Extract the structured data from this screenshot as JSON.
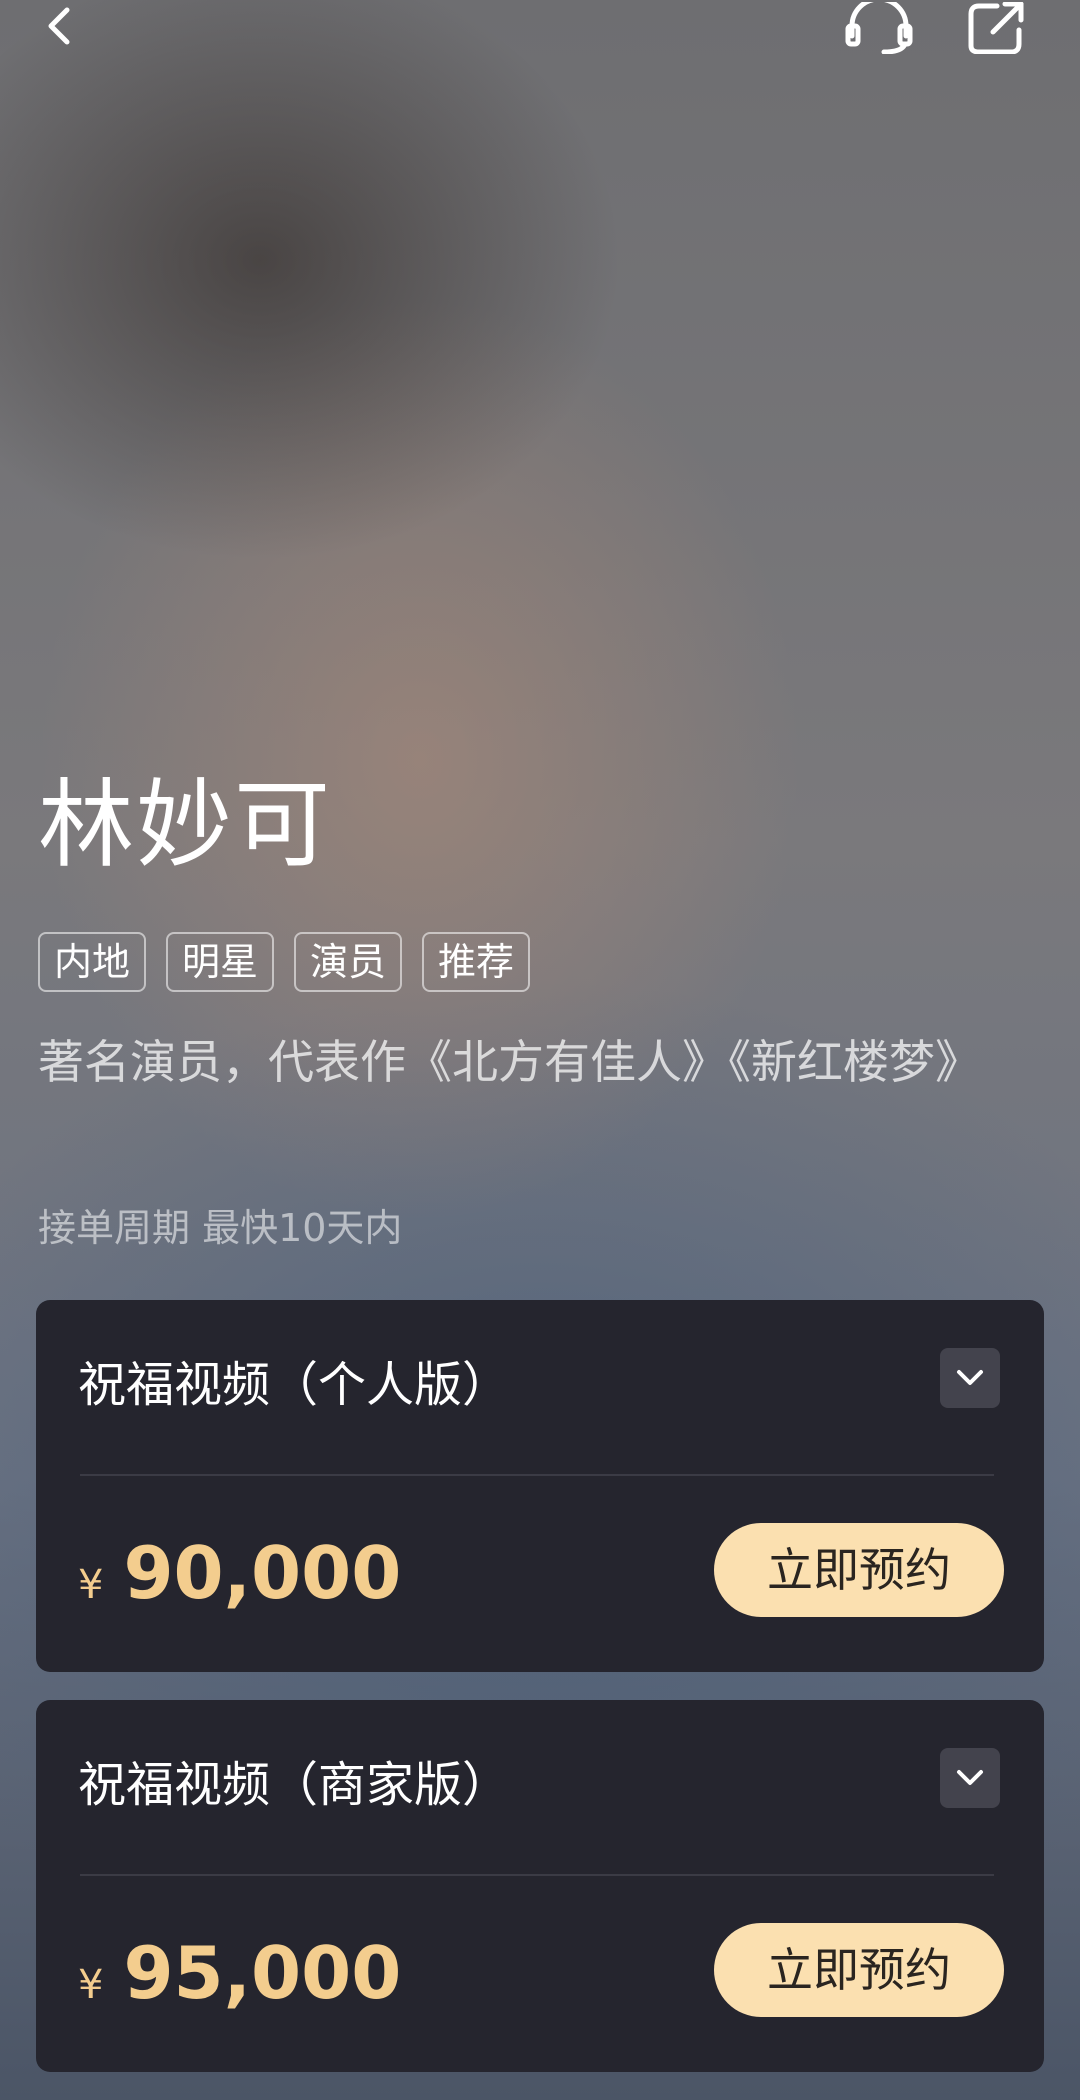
{
  "header": {
    "back_icon": "chevron-left-icon",
    "support_icon": "headset-icon",
    "share_icon": "share-icon"
  },
  "celebrity": {
    "name": "林妙可",
    "tags": [
      "内地",
      "明星",
      "演员",
      "推荐"
    ],
    "intro": "著名演员，代表作《北方有佳人》《新红楼梦》",
    "order_cycle": "接单周期 最快10天内"
  },
  "services": [
    {
      "title": "祝福视频（个人版）",
      "currency": "¥",
      "price": "90,000",
      "button_label": "立即预约"
    },
    {
      "title": "祝福视频（商家版）",
      "currency": "¥",
      "price": "95,000",
      "button_label": "立即预约"
    }
  ],
  "colors": {
    "card_background": "#25252e",
    "price": "#f3cd8e",
    "button_background": "#fbe0b0"
  }
}
